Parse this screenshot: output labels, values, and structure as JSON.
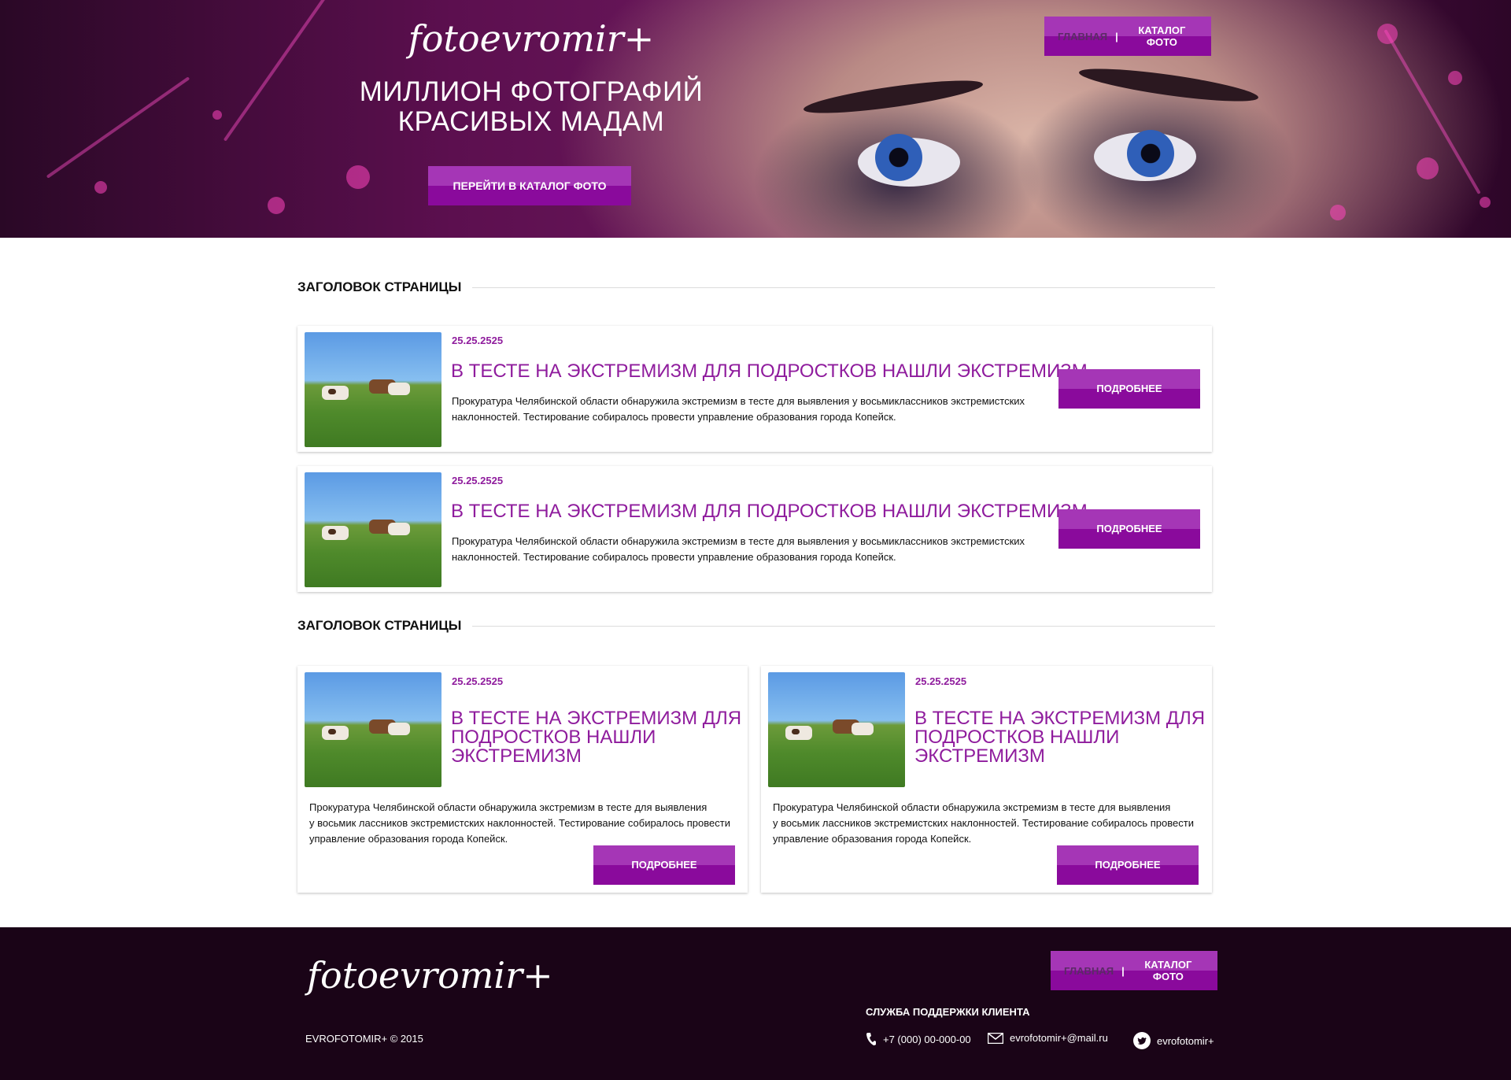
{
  "brand": {
    "logo": "fotoevromir+"
  },
  "hero": {
    "tagline_line1": "МИЛЛИОН ФОТОГРАФИЙ",
    "tagline_line2": "КРАСИВЫХ МАДАМ",
    "cta_label": "ПЕРЕЙТИ В КАТАЛОГ ФОТО"
  },
  "nav": {
    "home": "ГЛАВНАЯ",
    "separator": "|",
    "catalog": "КАТАЛОГ ФОТО"
  },
  "sections": [
    {
      "heading": "ЗАГОЛОВОК СТРАНИЦЫ"
    },
    {
      "heading": "ЗАГОЛОВОК СТРАНИЦЫ"
    }
  ],
  "wide_articles": [
    {
      "date": "25.25.2525",
      "title": "В ТЕСТЕ НА ЭКСТРЕМИЗМ ДЛЯ ПОДРОСТКОВ НАШЛИ ЭКСТРЕМИЗМ",
      "text_line1": "Прокуратура Челябинской области обнаружила экстремизм в тесте для выявления у восьмиклассников экстремистских",
      "text_line2": "наклонностей. Тестирование собиралось провести управление образования города Копейск.",
      "button": "ПОДРОБНЕЕ"
    },
    {
      "date": "25.25.2525",
      "title": "В ТЕСТЕ НА ЭКСТРЕМИЗМ ДЛЯ ПОДРОСТКОВ НАШЛИ ЭКСТРЕМИЗМ",
      "text_line1": "Прокуратура Челябинской области обнаружила экстремизм в тесте для выявления у восьмиклассников экстремистских",
      "text_line2": "наклонностей. Тестирование собиралось провести управление образования города Копейск.",
      "button": "ПОДРОБНЕЕ"
    }
  ],
  "grid_articles": [
    {
      "date": "25.25.2525",
      "title_line1": "В ТЕСТЕ НА ЭКСТРЕМИЗМ ДЛЯ",
      "title_line2": "ПОДРОСТКОВ НАШЛИ",
      "title_line3": "ЭКСТРЕМИЗМ",
      "text_line1": "Прокуратура Челябинской области обнаружила экстремизм в тесте для выявления",
      "text_line2": "у восьмик лассников экстремистских наклонностей. Тестирование собиралось провести",
      "text_line3": "управление образования города Копейск.",
      "button": "ПОДРОБНЕЕ"
    },
    {
      "date": "25.25.2525",
      "title_line1": "В ТЕСТЕ НА ЭКСТРЕМИЗМ ДЛЯ",
      "title_line2": "ПОДРОСТКОВ НАШЛИ",
      "title_line3": "ЭКСТРЕМИЗМ",
      "text_line1": "Прокуратура Челябинской области обнаружила экстремизм в тесте для выявления",
      "text_line2": "у восьмик лассников экстремистских наклонностей. Тестирование собиралось провести",
      "text_line3": "управление образования города Копейск.",
      "button": "ПОДРОБНЕЕ"
    }
  ],
  "footer": {
    "logo": "fotoevromir+",
    "copyright": "EVROFOTOMIR+ © 2015",
    "support_title": "СЛУЖБА ПОДДЕРЖКИ КЛИЕНТА",
    "phone": "+7 (000) 00-000-00",
    "email": "evrofotomir+@mail.ru",
    "twitter": "evrofotomir+"
  },
  "colors": {
    "accent": "#8f1c9d",
    "button_top": "#a536b6",
    "button_bottom": "#8a0a9c",
    "footer_bg": "#1a0417"
  },
  "icons": [
    "phone-icon",
    "mail-icon",
    "twitter-icon"
  ]
}
